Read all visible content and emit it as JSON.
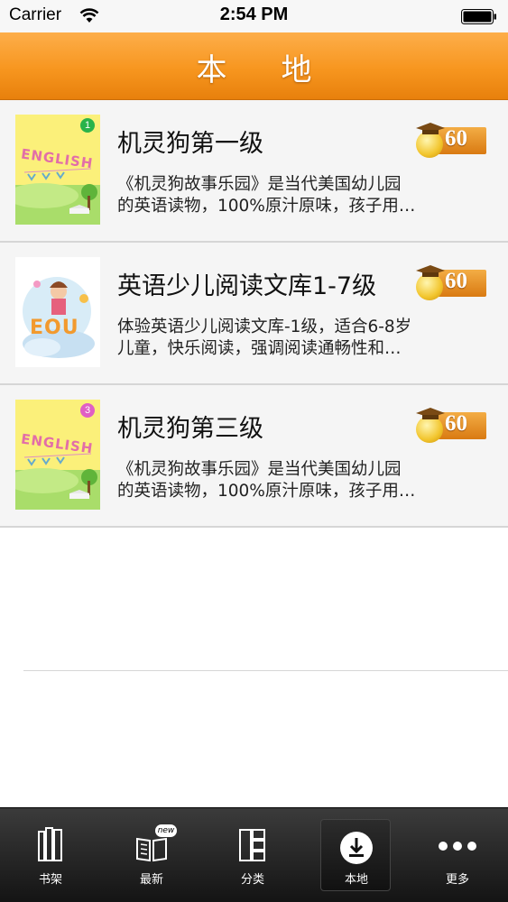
{
  "status_bar": {
    "carrier": "Carrier",
    "time": "2:54 PM"
  },
  "nav": {
    "title": "本地"
  },
  "books": [
    {
      "title": "机灵狗第一级",
      "desc_line1": "《机灵狗故事乐园》是当代美国幼儿园",
      "desc_line2": "的英语读物，100%原汁原味，孩子用…",
      "score": "60",
      "cover_badge": "1",
      "cover_text": "ENGLISH"
    },
    {
      "title": "英语少儿阅读文库1-7级",
      "desc_line1": "体验英语少儿阅读文库-1级，适合6-8岁",
      "desc_line2": "儿童，快乐阅读，强调阅读通畅性和…",
      "score": "60",
      "cover_text": "EOU"
    },
    {
      "title": "机灵狗第三级",
      "desc_line1": "《机灵狗故事乐园》是当代美国幼儿园",
      "desc_line2": "的英语读物，100%原汁原味，孩子用…",
      "score": "60",
      "cover_badge": "3",
      "cover_text": "ENGLISH"
    }
  ],
  "tabs": [
    {
      "label": "书架",
      "icon": "bookshelf-icon"
    },
    {
      "label": "最新",
      "icon": "open-book-icon",
      "badge": "new"
    },
    {
      "label": "分类",
      "icon": "category-icon"
    },
    {
      "label": "本地",
      "icon": "download-icon",
      "active": true
    },
    {
      "label": "更多",
      "icon": "more-dots-icon"
    }
  ],
  "colors": {
    "nav_orange": "#f7961f",
    "tab_bar": "#1e1e1e",
    "badge_green": "#29b34a",
    "badge_pink": "#e05fc4"
  }
}
